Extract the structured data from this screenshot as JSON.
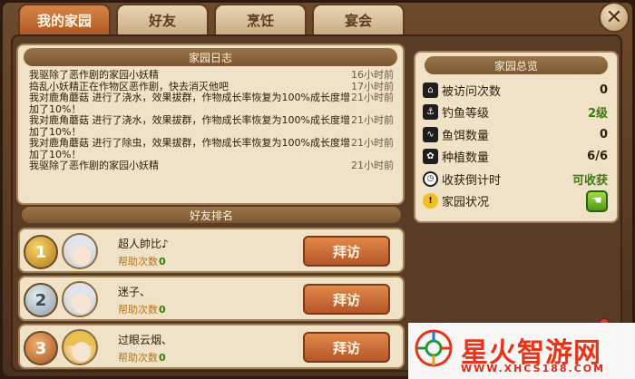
{
  "tabs": [
    {
      "label": "我的家园",
      "active": true
    },
    {
      "label": "好友",
      "active": false
    },
    {
      "label": "烹饪",
      "active": false
    },
    {
      "label": "宴会",
      "active": false
    }
  ],
  "close_symbol": "✕",
  "log": {
    "title": "家园日志",
    "entries": [
      {
        "text": "我驱除了恶作剧的家园小妖精",
        "time": "16小时前"
      },
      {
        "text": "捣乱小妖精正在作物区恶作剧，快去消灭他吧",
        "time": "17小时前"
      },
      {
        "text": "我对鹿角蘑菇 进行了浇水，效果拔群，作物成长率恢复为100%成长度增加了10%！",
        "time": "21小时前"
      },
      {
        "text": "我对鹿角蘑菇 进行了浇水，效果拔群，作物成长率恢复为100%成长度增加了10%！",
        "time": "21小时前"
      },
      {
        "text": "我对鹿角蘑菇 进行了除虫，效果拔群，作物成长率恢复为100%成长度增加了10%！",
        "time": "21小时前"
      },
      {
        "text": "我驱除了恶作剧的家园小妖精",
        "time": "21小时前"
      }
    ]
  },
  "ranking": {
    "title": "好友排名",
    "help_label": "帮助次数",
    "visit_label": "拜访",
    "friends": [
      {
        "rank": "1",
        "name": "超人帥比♪",
        "help": "0",
        "medal": "gold"
      },
      {
        "rank": "2",
        "name": "迷子、",
        "help": "0",
        "medal": "silver"
      },
      {
        "rank": "3",
        "name": "过眼云烟、",
        "help": "0",
        "medal": "bronze"
      }
    ]
  },
  "overview": {
    "title": "家园总览",
    "rows": [
      {
        "icon": "visits-icon",
        "label": "被访问次数",
        "value": "0"
      },
      {
        "icon": "fishing-icon",
        "label": "钓鱼等级",
        "value": "2级"
      },
      {
        "icon": "bait-icon",
        "label": "鱼饵数量",
        "value": "0"
      },
      {
        "icon": "plant-icon",
        "label": "种植数量",
        "value": "6/6"
      },
      {
        "icon": "clock-icon",
        "label": "收获倒计时",
        "value": "可收获"
      },
      {
        "icon": "warning-icon",
        "label": "家园状况",
        "value": ""
      }
    ]
  },
  "watermark": {
    "title": "星火智游网",
    "url": "WWW.XHCS188.COM"
  },
  "colors": {
    "accent_orange": "#b8552a",
    "help_green": "#3b7a10",
    "panel_bg": "#efe2c6"
  }
}
